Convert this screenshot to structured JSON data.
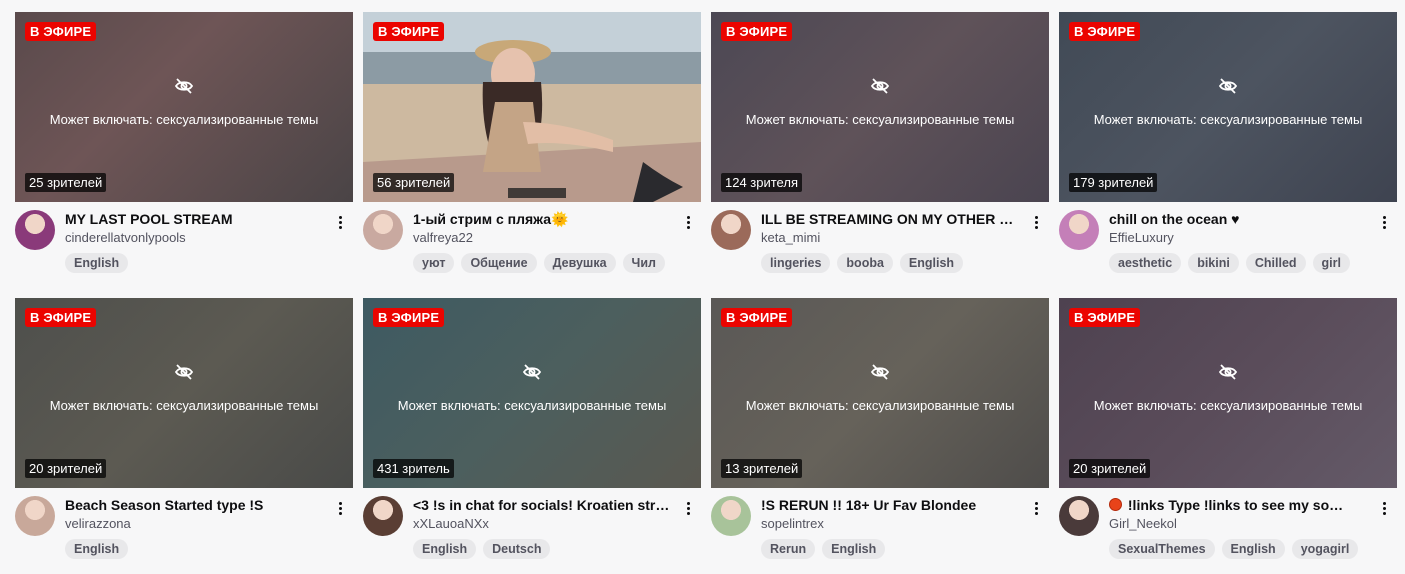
{
  "colors": {
    "live_badge": "#eb0400",
    "tag_bg": "#e8e8ea",
    "page_bg": "#f7f7f8"
  },
  "cards": [
    {
      "live": "В ЭФИРЕ",
      "warning": "Может включать: сексуализированные темы",
      "viewers": "25 зрителей",
      "title": "MY LAST POOL STREAM",
      "channel": "cinderellatvonlypools",
      "tags": [
        "English"
      ],
      "blurred": true,
      "bg": "linear-gradient(135deg,#5a4a4c 0%,#6e5556 40%,#4a4446 100%)",
      "avatar": "#8a3a7a"
    },
    {
      "live": "В ЭФИРЕ",
      "warning": "",
      "viewers": "56 зрителей",
      "title": "1-ый стрим с пляжа🌞",
      "channel": "valfreya22",
      "tags": [
        "уют",
        "Общение",
        "Девушка",
        "Чил"
      ],
      "blurred": false,
      "bg": "linear-gradient(180deg,#b9c9d6 0%,#a9b8c0 30%,#c8b7a2 45%,#d8c3a8 70%,#c7a892 100%)",
      "avatar": "#c9a9a0"
    },
    {
      "live": "В ЭФИРЕ",
      "warning": "Может включать: сексуализированные темы",
      "viewers": "124 зрителя",
      "title": "ILL BE STREAMING ON MY OTHER C…",
      "channel": "keta_mimi",
      "tags": [
        "lingeries",
        "booba",
        "English"
      ],
      "blurred": true,
      "bg": "linear-gradient(135deg,#4c4854 0%,#5f5259 50%,#4a4450 100%)",
      "avatar": "#9b6a5a"
    },
    {
      "live": "В ЭФИРЕ",
      "warning": "Может включать: сексуализированные темы",
      "viewers": "179 зрителей",
      "title": "chill on the ocean ♥",
      "channel": "EffieLuxury",
      "tags": [
        "aesthetic",
        "bikini",
        "Chilled",
        "girl"
      ],
      "blurred": true,
      "bg": "linear-gradient(135deg,#414a56 0%,#4d5460 50%,#3e4350 100%)",
      "avatar": "#c47fb8"
    },
    {
      "live": "В ЭФИРЕ",
      "warning": "Может включать: сексуализированные темы",
      "viewers": "20 зрителей",
      "title": "Beach Season Started type !S",
      "channel": "velirazzona",
      "tags": [
        "English"
      ],
      "blurred": true,
      "bg": "linear-gradient(135deg,#4e4f4c 0%,#5c5a52 50%,#494a48 100%)",
      "avatar": "#c8a89a"
    },
    {
      "live": "В ЭФИРЕ",
      "warning": "Может включать: сексуализированные темы",
      "viewers": "431 зритель",
      "title": "<3 !s in chat for socials! Kroatien stre…",
      "channel": "xXLauoaNXx",
      "tags": [
        "English",
        "Deutsch"
      ],
      "blurred": true,
      "bg": "linear-gradient(135deg,#3e5a62 0%,#4c5f5e 50%,#5a5850 100%)",
      "avatar": "#5a3e34"
    },
    {
      "live": "В ЭФИРЕ",
      "warning": "Может включать: сексуализированные темы",
      "viewers": "13 зрителей",
      "title": "!S RERUN !! 18+ Ur Fav Blondee",
      "channel": "sopelintrex",
      "tags": [
        "Rerun",
        "English"
      ],
      "blurred": true,
      "bg": "linear-gradient(135deg,#5a5856 0%,#66625a 50%,#4e4c4a 100%)",
      "avatar": "#a8c39a"
    },
    {
      "live": "В ЭФИРЕ",
      "warning": "Может включать: сексуализированные темы",
      "viewers": "20 зрителей",
      "title": "!links Type !links to see my so…",
      "channel": "Girl_Neekol",
      "tags": [
        "SexualThemes",
        "English",
        "yogagirl"
      ],
      "blurred": true,
      "bg": "linear-gradient(135deg,#4e4250 0%,#5a4c5a 50%,#645a68 100%)",
      "avatar": "#4a3a3a"
    }
  ]
}
